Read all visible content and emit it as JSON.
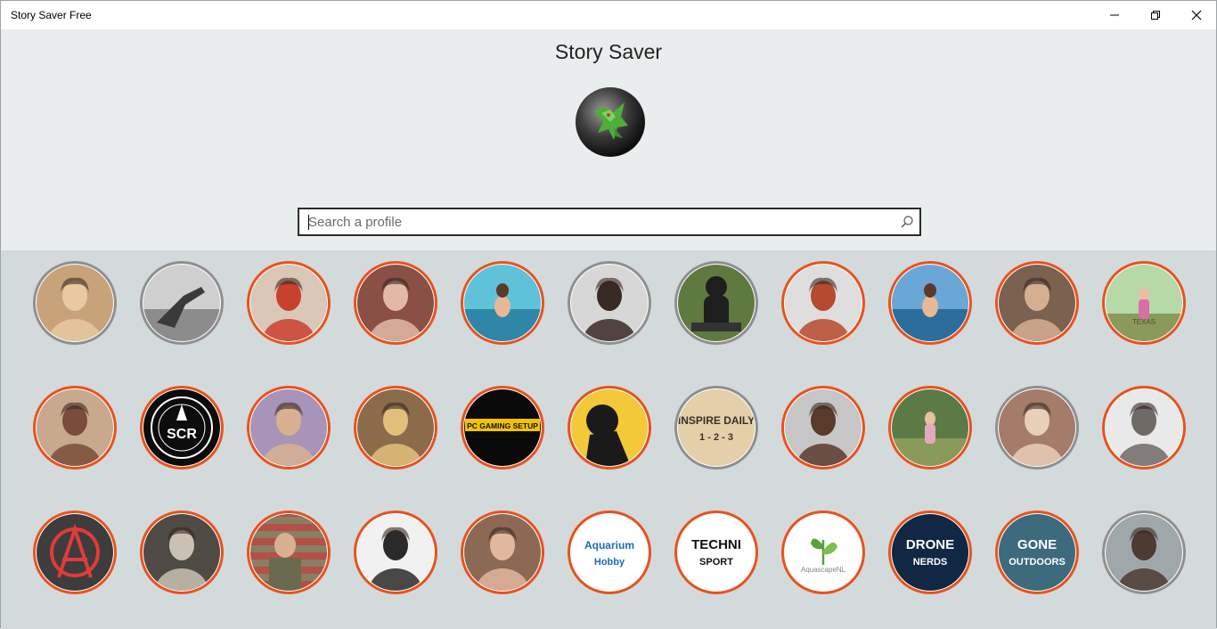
{
  "window": {
    "title": "Story Saver Free"
  },
  "header": {
    "title": "Story Saver"
  },
  "search": {
    "placeholder": "Search a profile",
    "value": ""
  },
  "colors": {
    "active_ring": "#e8521d",
    "inactive_ring": "#8f8f8f",
    "header_bg": "#e9edee",
    "grid_bg": "#d3dadc"
  },
  "profiles": [
    {
      "ring": "inactive",
      "bg": "#c8a37a",
      "fg": "#e8c9a0",
      "icon": "person-photo"
    },
    {
      "ring": "inactive",
      "bg": "#cfcfcf",
      "fg": "#3a3a3a",
      "icon": "bw-photo"
    },
    {
      "ring": "active",
      "bg": "#d9c8b8",
      "fg": "#c8402e",
      "icon": "person-photo"
    },
    {
      "ring": "active",
      "bg": "#8a4f45",
      "fg": "#e2b9a6",
      "icon": "person-photo"
    },
    {
      "ring": "active",
      "bg": "#5ec2d8",
      "fg": "#2f86a6",
      "icon": "beach-photo"
    },
    {
      "ring": "inactive",
      "bg": "#d7d7d7",
      "fg": "#3a2a26",
      "icon": "person-photo"
    },
    {
      "ring": "inactive",
      "bg": "#5f7a3f",
      "fg": "#1e1e1e",
      "icon": "moto-photo"
    },
    {
      "ring": "active",
      "bg": "#dedede",
      "fg": "#b64a2e",
      "icon": "person-photo"
    },
    {
      "ring": "active",
      "bg": "#6aa7d6",
      "fg": "#2c6d9c",
      "icon": "beach-photo"
    },
    {
      "ring": "active",
      "bg": "#7a6150",
      "fg": "#d6ae92",
      "icon": "person-photo"
    },
    {
      "ring": "active",
      "bg": "#b7d9a8",
      "fg": "#d96ea8",
      "icon": "outdoor-photo",
      "text": "TEXAS"
    },
    {
      "ring": "active",
      "bg": "#c9a98e",
      "fg": "#7a4d3a",
      "icon": "person-photo"
    },
    {
      "ring": "active",
      "bg": "#0c0c0c",
      "fg": "#ffffff",
      "icon": "logo-badge",
      "text": "SCR"
    },
    {
      "ring": "active",
      "bg": "#a894b8",
      "fg": "#d8b090",
      "icon": "person-photo"
    },
    {
      "ring": "active",
      "bg": "#8c6b4b",
      "fg": "#e2c07b",
      "icon": "person-photo"
    },
    {
      "ring": "active",
      "bg": "#0a0a0a",
      "fg": "#f2c200",
      "icon": "logo-banner",
      "text": "PC GAMING SETUP"
    },
    {
      "ring": "active",
      "bg": "#f3c93a",
      "fg": "#1a1a1a",
      "icon": "silhouette"
    },
    {
      "ring": "inactive",
      "bg": "#e3cfa8",
      "fg": "#3a3228",
      "icon": "text-logo",
      "text": "INSPIRE DAILY",
      "text2": "1 - 2 - 3"
    },
    {
      "ring": "active",
      "bg": "#c6c6c6",
      "fg": "#5a3a2a",
      "icon": "person-photo"
    },
    {
      "ring": "active",
      "bg": "#5b7a46",
      "fg": "#e5a8c0",
      "icon": "outdoor-photo"
    },
    {
      "ring": "inactive",
      "bg": "#a57b6a",
      "fg": "#e8cfb8",
      "icon": "person-photo"
    },
    {
      "ring": "active",
      "bg": "#e9e9e9",
      "fg": "#6f6a66",
      "icon": "person-photo"
    },
    {
      "ring": "active",
      "bg": "#3d3d3d",
      "fg": "#e33a3a",
      "icon": "anarchy-logo"
    },
    {
      "ring": "active",
      "bg": "#4f4a44",
      "fg": "#c9c1b2",
      "icon": "person-photo"
    },
    {
      "ring": "active",
      "bg": "#8a7f63",
      "fg": "#c43c3c",
      "icon": "flag-photo"
    },
    {
      "ring": "active",
      "bg": "#f1f1f1",
      "fg": "#2a2a2a",
      "icon": "person-photo"
    },
    {
      "ring": "active",
      "bg": "#8c6955",
      "fg": "#e1b79d",
      "icon": "person-photo"
    },
    {
      "ring": "active",
      "bg": "#ffffff",
      "fg": "#1c6bb8",
      "icon": "text-logo",
      "text": "Aquarium",
      "text2": "Hobby"
    },
    {
      "ring": "active",
      "bg": "#ffffff",
      "fg": "#111111",
      "icon": "text-logo",
      "text": "TECHNI",
      "text2": "SPORT"
    },
    {
      "ring": "active",
      "bg": "#ffffff",
      "fg": "#58a23c",
      "icon": "plant-logo",
      "text": "AquascapeNL"
    },
    {
      "ring": "active",
      "bg": "#102844",
      "fg": "#ffffff",
      "icon": "text-logo",
      "text": "DRONE",
      "text2": "NERDS"
    },
    {
      "ring": "active",
      "bg": "#3e6a7e",
      "fg": "#ffffff",
      "icon": "text-logo",
      "text": "GONE",
      "text2": "OUTDOORS"
    },
    {
      "ring": "inactive",
      "bg": "#a0a7aa",
      "fg": "#4d3a32",
      "icon": "person-photo"
    }
  ]
}
